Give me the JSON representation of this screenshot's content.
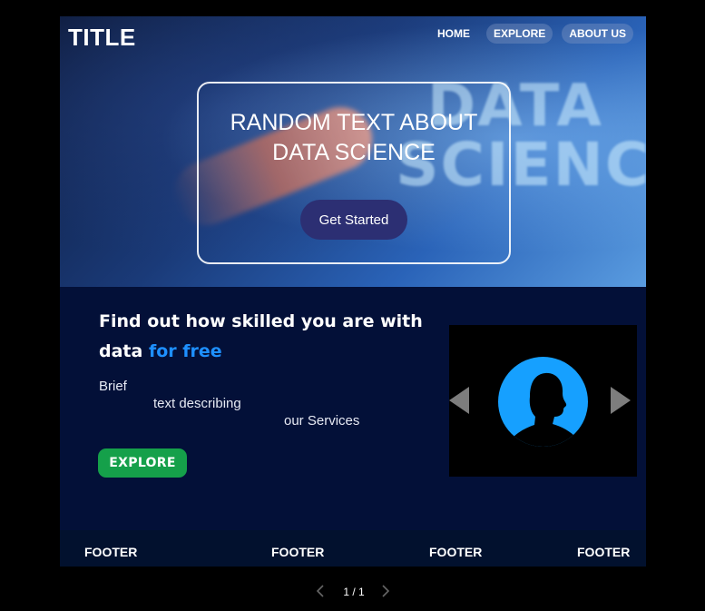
{
  "header": {
    "brand": "TITLE",
    "nav": [
      {
        "label": "HOME"
      },
      {
        "label": "EXPLORE"
      },
      {
        "label": "ABOUT US"
      }
    ]
  },
  "hero": {
    "heading_line1": "RANDOM TEXT ABOUT",
    "heading_line2": "DATA SCIENCE",
    "background_word1": "DATA",
    "background_word2": "SCIENCE",
    "cta_label": "Get Started"
  },
  "services": {
    "headline_part1": "Find out how skilled you are with",
    "headline_part2": "data",
    "headline_accent": "for free",
    "description_line1": "Brief",
    "description_line2": "text  describing",
    "description_line3": "our Services",
    "explore_label": "EXPLORE"
  },
  "footer": {
    "items": [
      "FOOTER",
      "FOOTER",
      "FOOTER",
      "FOOTER"
    ]
  },
  "pager": {
    "text": "1 / 1"
  },
  "colors": {
    "services_bg": "#031038",
    "accent": "#1e90ff",
    "explore_button": "#15a04a",
    "cta_button": "#2c2f73",
    "avatar_circle": "#16a0ff"
  },
  "icons": {
    "carousel_prev": "triangle-left-icon",
    "carousel_next": "triangle-right-icon",
    "avatar": "person-silhouette-icon",
    "pager_prev": "chevron-left-icon",
    "pager_next": "chevron-right-icon"
  }
}
